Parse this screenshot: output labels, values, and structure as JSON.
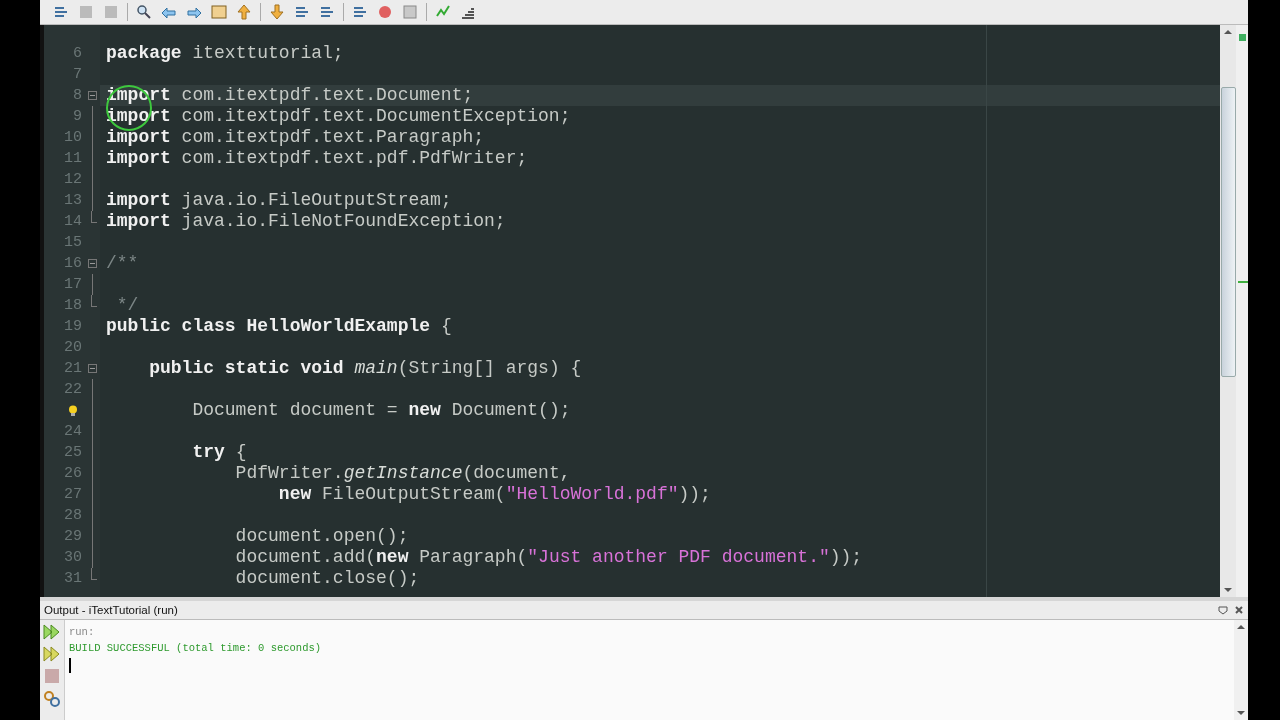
{
  "editor": {
    "lines": [
      {
        "number": "6",
        "foldable": false,
        "in_fold": false,
        "hint": false,
        "current": false,
        "tokens": [
          {
            "kind": "keyword",
            "text": "package"
          },
          {
            "kind": "plain",
            "text": " itexttutorial;"
          }
        ]
      },
      {
        "number": "7",
        "foldable": false,
        "in_fold": false,
        "hint": false,
        "current": false
      },
      {
        "number": "8",
        "foldable": true,
        "in_fold": false,
        "hint": false,
        "current": true,
        "tokens": [
          {
            "kind": "keyword",
            "text": "import"
          },
          {
            "kind": "plain",
            "text": " com.itextpdf.text.Document;"
          }
        ]
      },
      {
        "number": "9",
        "foldable": false,
        "in_fold": true,
        "hint": false,
        "current": false,
        "tokens": [
          {
            "kind": "keyword",
            "text": "import"
          },
          {
            "kind": "plain",
            "text": " com.itextpdf.text.DocumentException;"
          }
        ]
      },
      {
        "number": "10",
        "foldable": false,
        "in_fold": true,
        "hint": false,
        "current": false,
        "tokens": [
          {
            "kind": "keyword",
            "text": "import"
          },
          {
            "kind": "plain",
            "text": " com.itextpdf.text.Paragraph;"
          }
        ]
      },
      {
        "number": "11",
        "foldable": false,
        "in_fold": true,
        "hint": false,
        "current": false,
        "tokens": [
          {
            "kind": "keyword",
            "text": "import"
          },
          {
            "kind": "plain",
            "text": " com.itextpdf.text.pdf.PdfWriter;"
          }
        ]
      },
      {
        "number": "12",
        "foldable": false,
        "in_fold": true,
        "hint": false,
        "current": false
      },
      {
        "number": "13",
        "foldable": false,
        "in_fold": true,
        "hint": false,
        "current": false,
        "tokens": [
          {
            "kind": "keyword",
            "text": "import"
          },
          {
            "kind": "plain",
            "text": " java.io.FileOutputStream;"
          }
        ]
      },
      {
        "number": "14",
        "foldable": false,
        "in_fold": true,
        "hint": false,
        "current": false,
        "tokens": [
          {
            "kind": "keyword",
            "text": "import"
          },
          {
            "kind": "plain",
            "text": " java.io.FileNotFoundException;"
          }
        ]
      },
      {
        "number": "15",
        "foldable": false,
        "in_fold": false,
        "hint": false,
        "current": false
      },
      {
        "number": "16",
        "foldable": true,
        "in_fold": false,
        "hint": false,
        "current": false,
        "tokens": [
          {
            "kind": "comment",
            "text": "/**"
          }
        ]
      },
      {
        "number": "17",
        "foldable": false,
        "in_fold": true,
        "hint": false,
        "current": false
      },
      {
        "number": "18",
        "foldable": false,
        "in_fold": true,
        "hint": false,
        "current": false,
        "tokens": [
          {
            "kind": "comment",
            "text": " */"
          }
        ]
      },
      {
        "number": "19",
        "foldable": false,
        "in_fold": false,
        "hint": false,
        "current": false,
        "tokens": [
          {
            "kind": "keyword",
            "text": "public class "
          },
          {
            "kind": "keyword",
            "text": "HelloWorldExample"
          },
          {
            "kind": "plain",
            "text": " {"
          }
        ]
      },
      {
        "number": "20",
        "foldable": false,
        "in_fold": false,
        "hint": false,
        "current": false
      },
      {
        "number": "21",
        "foldable": true,
        "in_fold": false,
        "hint": false,
        "current": false,
        "tokens": [
          {
            "kind": "keyword",
            "text": "    public static void "
          },
          {
            "kind": "method",
            "text": "main"
          },
          {
            "kind": "plain",
            "text": "(String[] args) {"
          }
        ]
      },
      {
        "number": "22",
        "foldable": false,
        "in_fold": true,
        "hint": false,
        "current": false
      },
      {
        "foldable": false,
        "in_fold": true,
        "hint": true,
        "current": false,
        "tokens": [
          {
            "kind": "plain",
            "text": "        Document document = "
          },
          {
            "kind": "keyword",
            "text": "new"
          },
          {
            "kind": "plain",
            "text": " Document();"
          }
        ]
      },
      {
        "number": "24",
        "foldable": false,
        "in_fold": true,
        "hint": false,
        "current": false
      },
      {
        "number": "25",
        "foldable": false,
        "in_fold": true,
        "hint": false,
        "current": false,
        "tokens": [
          {
            "kind": "keyword",
            "text": "        try"
          },
          {
            "kind": "plain",
            "text": " {"
          }
        ]
      },
      {
        "number": "26",
        "foldable": false,
        "in_fold": true,
        "hint": false,
        "current": false,
        "tokens": [
          {
            "kind": "plain",
            "text": "            PdfWriter."
          },
          {
            "kind": "method",
            "text": "getInstance"
          },
          {
            "kind": "plain",
            "text": "(document,"
          }
        ]
      },
      {
        "number": "27",
        "foldable": false,
        "in_fold": true,
        "hint": false,
        "current": false,
        "tokens": [
          {
            "kind": "keyword",
            "text": "                new"
          },
          {
            "kind": "plain",
            "text": " FileOutputStream("
          },
          {
            "kind": "string",
            "text": "\"HelloWorld.pdf\""
          },
          {
            "kind": "plain",
            "text": "));"
          }
        ]
      },
      {
        "number": "28",
        "foldable": false,
        "in_fold": true,
        "hint": false,
        "current": false
      },
      {
        "number": "29",
        "foldable": false,
        "in_fold": true,
        "hint": false,
        "current": false,
        "tokens": [
          {
            "kind": "plain",
            "text": "            document.open();"
          }
        ]
      },
      {
        "number": "30",
        "foldable": false,
        "in_fold": true,
        "hint": false,
        "current": false,
        "tokens": [
          {
            "kind": "plain",
            "text": "            document.add("
          },
          {
            "kind": "keyword",
            "text": "new"
          },
          {
            "kind": "plain",
            "text": " Paragraph("
          },
          {
            "kind": "string",
            "text": "\"Just another PDF document.\""
          },
          {
            "kind": "plain",
            "text": "));"
          }
        ]
      },
      {
        "number": "31",
        "foldable": false,
        "in_fold": true,
        "hint": false,
        "current": false,
        "tokens": [
          {
            "kind": "plain",
            "text": "            document.close();"
          }
        ]
      }
    ]
  },
  "output": {
    "title": "Output - iTextTutorial (run)",
    "lines": [
      {
        "kind": "info",
        "text": "run:"
      },
      {
        "kind": "success",
        "text": "BUILD SUCCESSFUL (total time: 0 seconds)"
      }
    ]
  }
}
